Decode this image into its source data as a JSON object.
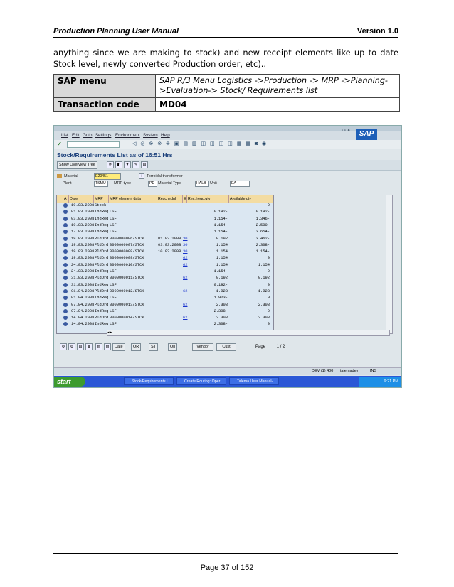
{
  "header": {
    "left": "Production Planning User Manual",
    "right": "Version 1.0"
  },
  "paragraph": "anything since we are making to stock) and new receipt elements like up to date Stock level, newly converted Production order, etc)..",
  "info_table": [
    {
      "key": "SAP menu",
      "value": "SAP R/3 Menu Logistics ->Production -> MRP ->Planning->Evaluation-> Stock/ Requirements list"
    },
    {
      "key": "Transaction code",
      "value": "MD04"
    }
  ],
  "sap": {
    "menu": [
      "List",
      "Edit",
      "Goto",
      "Settings",
      "Environment",
      "System",
      "Help"
    ],
    "logo": "SAP",
    "title": "Stock/Requirements List as of 16:51 Hrs",
    "show_overview_tree": "Show Overview Tree",
    "material_label": "Material",
    "material_value": "E20451",
    "material_desc": "Torroidal transformer",
    "plant_label": "Plant",
    "plant_value": "TSMU",
    "mrp_type_label": "MRP type",
    "mrp_type_value": "PD",
    "material_type_label": "Material Type",
    "material_type_value": "HALB",
    "unit_label": "Unit",
    "unit_value": "EA",
    "columns": [
      "A",
      "Date",
      "MRP",
      "MRP element data",
      "Reschedul",
      "E",
      "Rec./reqd.qty",
      "Available qty"
    ],
    "rows": [
      {
        "date": "19.03.2008",
        "mrp": "Stock",
        "data": "",
        "resch": "",
        "e": "",
        "qty": "",
        "avail": "0"
      },
      {
        "date": "01.03.2008",
        "mrp": "IndReq",
        "data": "LSF",
        "resch": "",
        "e": "",
        "qty": "0.192-",
        "avail": "0.192-"
      },
      {
        "date": "03.03.2008",
        "mrp": "IndReq",
        "data": "LSF",
        "resch": "",
        "e": "",
        "qty": "1.154-",
        "avail": "1.346-"
      },
      {
        "date": "10.03.2008",
        "mrp": "IndReq",
        "data": "LSF",
        "resch": "",
        "e": "",
        "qty": "1.154-",
        "avail": "2.500-"
      },
      {
        "date": "17.03.2008",
        "mrp": "IndReq",
        "data": "LSF",
        "resch": "",
        "e": "",
        "qty": "1.154-",
        "avail": "3.654-"
      },
      {
        "date": "19.03.2008",
        "mrp": "PldOrd",
        "data": "0000000006/STCK",
        "resch": "01.03.2008",
        "e": "30",
        "qty": "0.192",
        "avail": "3.462-"
      },
      {
        "date": "19.03.2008",
        "mrp": "PldOrd",
        "data": "0000000007/STCK",
        "resch": "03.03.2008",
        "e": "30",
        "qty": "1.154",
        "avail": "2.308-"
      },
      {
        "date": "19.03.2008",
        "mrp": "PldOrd",
        "data": "0000000008/STCK",
        "resch": "10.03.2008",
        "e": "30",
        "qty": "1.154",
        "avail": "1.154-"
      },
      {
        "date": "19.03.2008",
        "mrp": "PldOrd",
        "data": "0000000009/STCK",
        "resch": "",
        "e": "62",
        "qty": "1.154",
        "avail": "0"
      },
      {
        "date": "24.03.2008",
        "mrp": "PldOrd",
        "data": "0000000010/STCK",
        "resch": "",
        "e": "62",
        "qty": "1.154",
        "avail": "1.154"
      },
      {
        "date": "24.03.2008",
        "mrp": "IndReq",
        "data": "LSF",
        "resch": "",
        "e": "",
        "qty": "1.154-",
        "avail": "0"
      },
      {
        "date": "31.03.2008",
        "mrp": "PldOrd",
        "data": "0000000011/STCK",
        "resch": "",
        "e": "62",
        "qty": "0.192",
        "avail": "0.192"
      },
      {
        "date": "31.03.2008",
        "mrp": "IndReq",
        "data": "LSF",
        "resch": "",
        "e": "",
        "qty": "0.192-",
        "avail": "0"
      },
      {
        "date": "01.04.2008",
        "mrp": "PldOrd",
        "data": "0000000012/STCK",
        "resch": "",
        "e": "62",
        "qty": "1.923",
        "avail": "1.923"
      },
      {
        "date": "01.04.2008",
        "mrp": "IndReq",
        "data": "LSF",
        "resch": "",
        "e": "",
        "qty": "1.923-",
        "avail": "0"
      },
      {
        "date": "07.04.2008",
        "mrp": "PldOrd",
        "data": "0000000013/STCK",
        "resch": "",
        "e": "62",
        "qty": "2.308",
        "avail": "2.308"
      },
      {
        "date": "07.04.2008",
        "mrp": "IndReq",
        "data": "LSF",
        "resch": "",
        "e": "",
        "qty": "2.308-",
        "avail": "0"
      },
      {
        "date": "14.04.2008",
        "mrp": "PldOrd",
        "data": "0000000014/STCK",
        "resch": "",
        "e": "62",
        "qty": "2.308",
        "avail": "2.308"
      },
      {
        "date": "14.04.2008",
        "mrp": "IndReq",
        "data": "LSF",
        "resch": "",
        "e": "",
        "qty": "2.308-",
        "avail": "0"
      }
    ],
    "bottom_buttons": [
      "Date",
      "OR",
      "ST",
      "On",
      "Vendor",
      "Cust"
    ],
    "page_label": "Page",
    "page_value": "1 / 2",
    "status": {
      "system": "DEV (1) 400",
      "server": "talemadev",
      "mode": "INS"
    },
    "taskbar": {
      "start": "start",
      "tasks": [
        "Stock/Requirements L...",
        "Create Routing: Oper...",
        "Talema User Manual-..."
      ],
      "time": "9:21 PM"
    }
  },
  "footer": {
    "page": "Page 37 of 152"
  }
}
